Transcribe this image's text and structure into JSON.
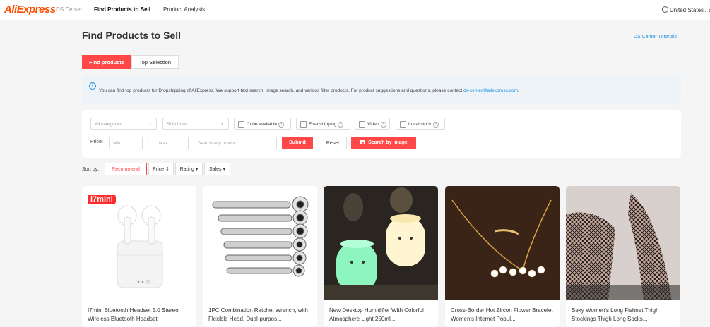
{
  "header": {
    "logo": "AliExpress",
    "logo_sub": "DS Center",
    "nav": [
      "Find Products to Sell",
      "Product Analysis"
    ],
    "region": "United States / E"
  },
  "page": {
    "title": "Find Products to Sell",
    "tutorials_link": "DS Center Tutorials"
  },
  "tabs": [
    "Find products",
    "Top Selection"
  ],
  "info": {
    "icon": "info-icon",
    "text": "You can find top products for Dropshipping of AliExpress. We support text search, image search, and various filter products. For product suggestions and questions, please contact ",
    "email": "ds-center@aliexpress.com",
    "suffix": "."
  },
  "filters": {
    "category_placeholder": "All categories",
    "ship_from_placeholder": "Ship from",
    "checkboxes": [
      "Code available",
      "Free shipping",
      "Video",
      "Local stock"
    ],
    "price_label": "Price:",
    "min_placeholder": "Min",
    "dash": "-",
    "max_placeholder": "Max",
    "search_placeholder": "Search any product",
    "submit": "Submit",
    "reset": "Reset",
    "search_by_image": "Search by image"
  },
  "sort": {
    "label": "Sort by:",
    "options": [
      "Recommend",
      "Price ⇕",
      "Rating ▾",
      "Sales ▾"
    ]
  },
  "products": [
    {
      "name": "I7mini Bluetooth Headset 5.0 Stereo Wireless Bluetooth Headset",
      "badge": "i7mini"
    },
    {
      "name": "1PC Combination Ratchet Wrench, with Flexible Head, Dual-purpos..."
    },
    {
      "name": "New Desktop Humidifier With Colorful Atmosphere Light 250ml..."
    },
    {
      "name": "Cross-Border Hot Zircon Flower Bracelet Women's Internet Popul..."
    },
    {
      "name": "Sexy Women's Long Fishnet Thigh Stockings Thigh Long Socks..."
    }
  ],
  "colors": {
    "accent": "#ff4747",
    "link": "#1a8fe0",
    "brand": "#ff4d00"
  }
}
